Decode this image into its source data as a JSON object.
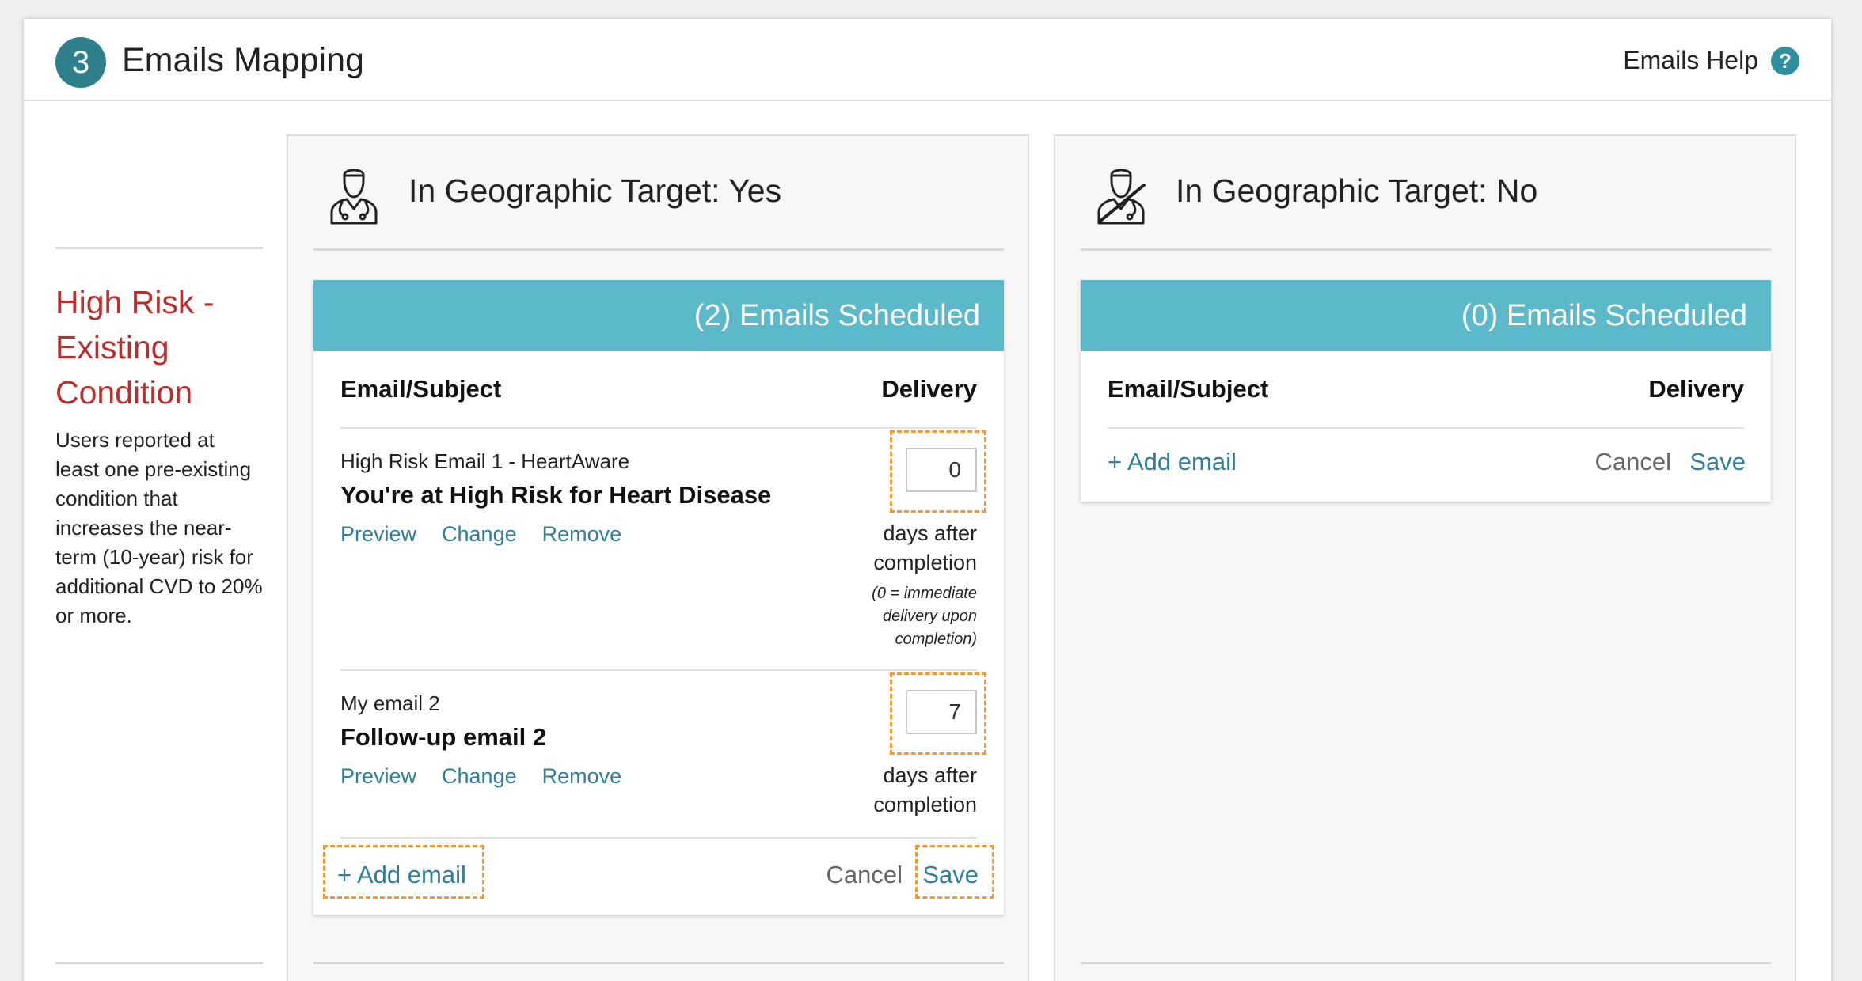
{
  "header": {
    "step_number": "3",
    "title": "Emails Mapping",
    "help_label": "Emails Help"
  },
  "condition": {
    "title": "High Risk - Existing Condition",
    "description": "Users reported at least one pre-existing condition that increases the near-term (10-year) risk for additional CVD to 20% or more."
  },
  "columns": [
    {
      "title": "In Geographic Target: Yes",
      "icon": "doctor-icon",
      "scheduled_label": "(2) Emails Scheduled",
      "col_subject": "Email/Subject",
      "col_delivery": "Delivery",
      "emails": [
        {
          "name": "High Risk Email 1 - HeartAware",
          "subject": "You're at High Risk for Heart Disease",
          "delivery_days": "0",
          "delivery_label": "days after completion",
          "delivery_note": "(0 = immediate delivery upon completion)",
          "actions": [
            "Preview",
            "Change",
            "Remove"
          ]
        },
        {
          "name": "My email 2",
          "subject": "Follow-up email 2",
          "delivery_days": "7",
          "delivery_label": "days after completion",
          "actions": [
            "Preview",
            "Change",
            "Remove"
          ]
        }
      ],
      "add_email": "+ Add email",
      "cancel": "Cancel",
      "save": "Save"
    },
    {
      "title": "In Geographic Target: No",
      "icon": "doctor-slash-icon",
      "scheduled_label": "(0) Emails Scheduled",
      "col_subject": "Email/Subject",
      "col_delivery": "Delivery",
      "emails": [],
      "add_email": "+ Add email",
      "cancel": "Cancel",
      "save": "Save"
    }
  ],
  "colors": {
    "accent": "#2e7f8c",
    "card_header": "#5cb9c9",
    "link": "#2e7f9a",
    "condition_title": "#b8302d",
    "highlight_dash": "#ef9b3a"
  }
}
